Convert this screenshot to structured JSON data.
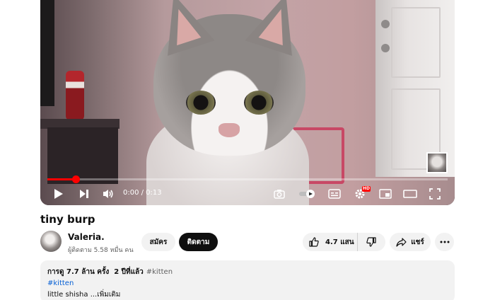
{
  "player": {
    "time_display": "0:00 / 0:13",
    "progress_fraction": 0.07,
    "hd_badge": "HD"
  },
  "video": {
    "title": "tiny burp"
  },
  "channel": {
    "name": "Valeria.",
    "subscribers": "ผู้ติดตาม 5.58 หมื่น คน",
    "join_label": "สมัคร",
    "subscribe_label": "ติดตาม"
  },
  "actions": {
    "like_count": "4.7 แสน",
    "share_label": "แชร์"
  },
  "description": {
    "views": "การดู 7.7 ล้าน ครั้ง",
    "age": "2 ปีที่แล้ว",
    "hashtag_inline": "#kitten",
    "hashtag_link": "#kitten",
    "text": "little shisha ...เพิ่มเติม"
  },
  "colors": {
    "progress": "#ff0000",
    "link": "#065fd4",
    "subscribe_bg": "#0f0f0f"
  },
  "icons": [
    "play-icon",
    "next-icon",
    "volume-icon",
    "camera-icon",
    "autoplay-toggle-icon",
    "subtitles-icon",
    "settings-icon",
    "miniplayer-icon",
    "theater-icon",
    "fullscreen-icon",
    "thumbs-up-icon",
    "thumbs-down-icon",
    "share-icon",
    "more-icon"
  ]
}
